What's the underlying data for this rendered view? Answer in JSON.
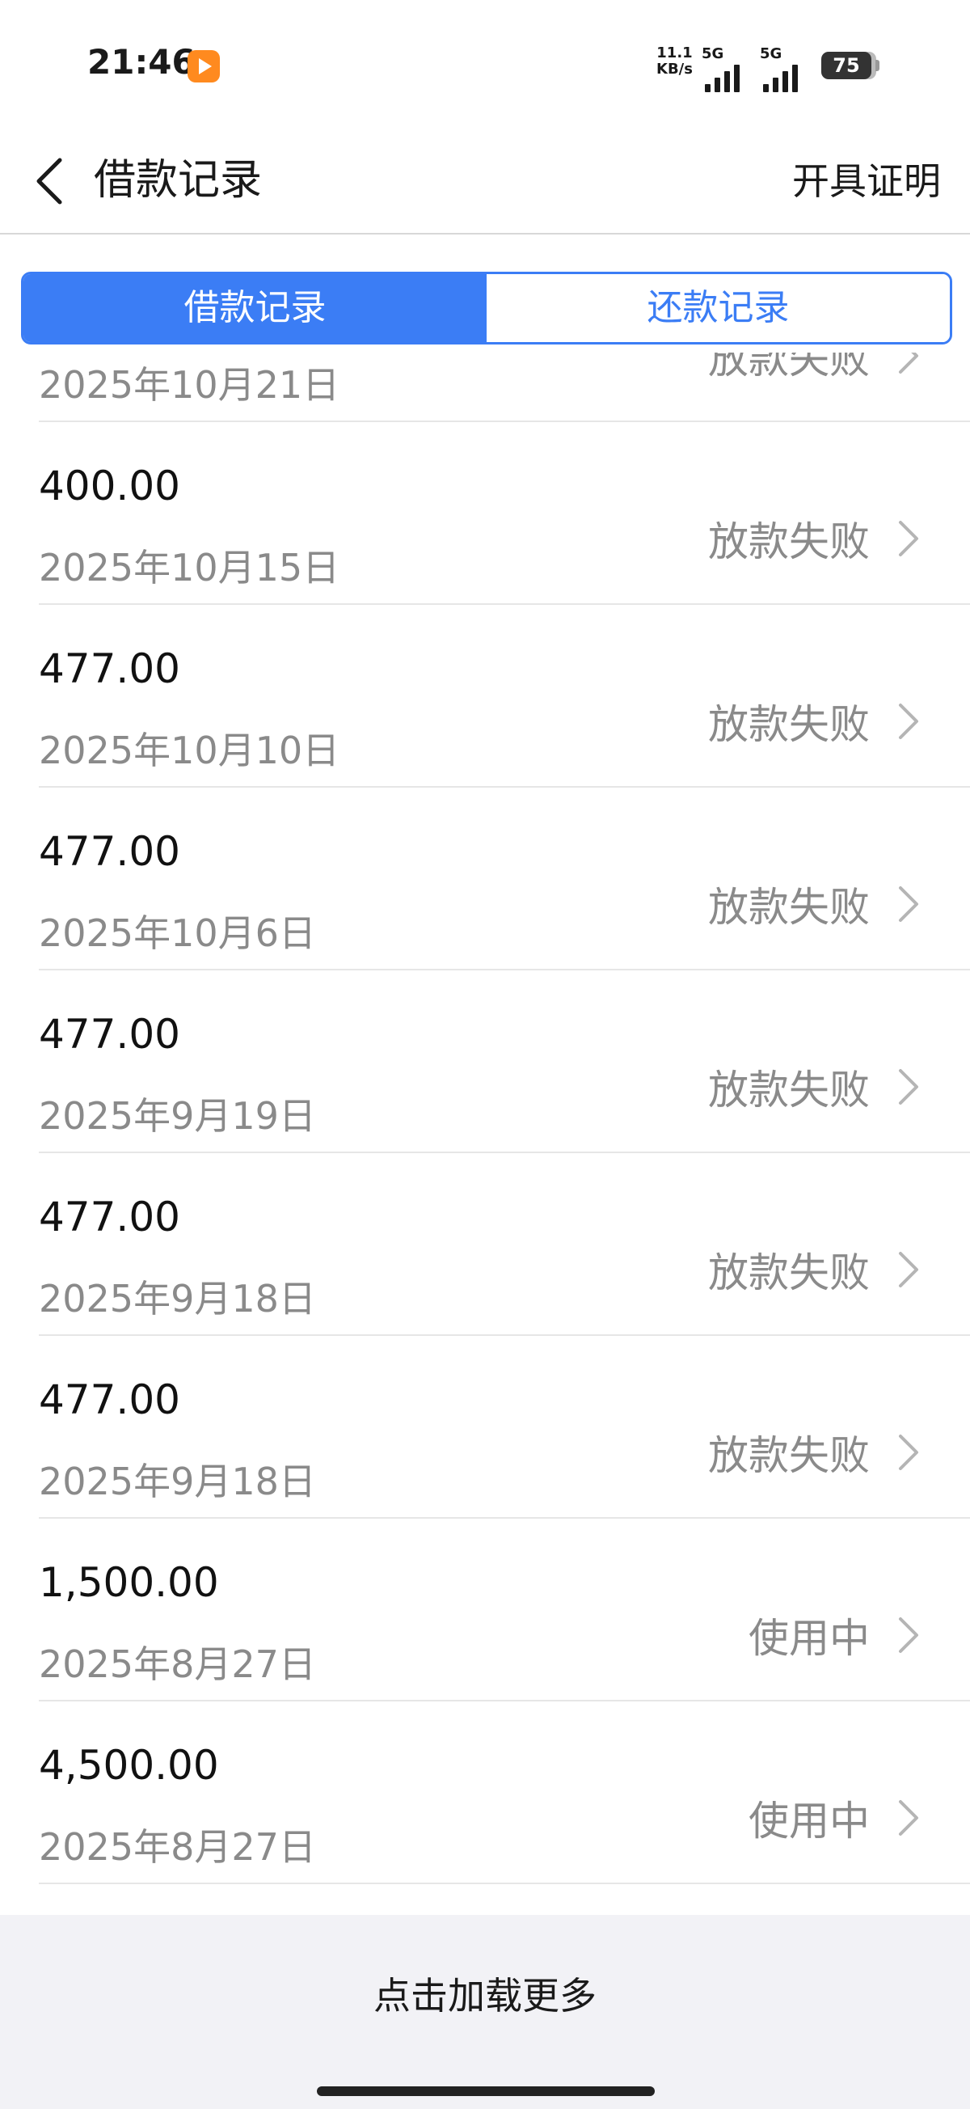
{
  "status_bar": {
    "time": "21:46",
    "net_speed_value": "11.1",
    "net_speed_unit": "KB/s",
    "signal_1_label": "5G",
    "signal_2_label": "5G",
    "battery": "75"
  },
  "nav": {
    "title": "借款记录",
    "action": "开具证明"
  },
  "tabs": [
    {
      "label": "借款记录",
      "active": true
    },
    {
      "label": "还款记录",
      "active": false
    }
  ],
  "records": [
    {
      "amount": "",
      "date": "2025年10月21日",
      "status": "放款失败"
    },
    {
      "amount": "400.00",
      "date": "2025年10月15日",
      "status": "放款失败"
    },
    {
      "amount": "477.00",
      "date": "2025年10月10日",
      "status": "放款失败"
    },
    {
      "amount": "477.00",
      "date": "2025年10月6日",
      "status": "放款失败"
    },
    {
      "amount": "477.00",
      "date": "2025年9月19日",
      "status": "放款失败"
    },
    {
      "amount": "477.00",
      "date": "2025年9月18日",
      "status": "放款失败"
    },
    {
      "amount": "477.00",
      "date": "2025年9月18日",
      "status": "放款失败"
    },
    {
      "amount": "1,500.00",
      "date": "2025年8月27日",
      "status": "使用中"
    },
    {
      "amount": "4,500.00",
      "date": "2025年8月27日",
      "status": "使用中"
    }
  ],
  "footer": {
    "load_more": "点击加载更多"
  },
  "colors": {
    "accent": "#3b7df5",
    "muted_text": "#8a8a8a",
    "footer_bg": "#f2f2f6"
  }
}
